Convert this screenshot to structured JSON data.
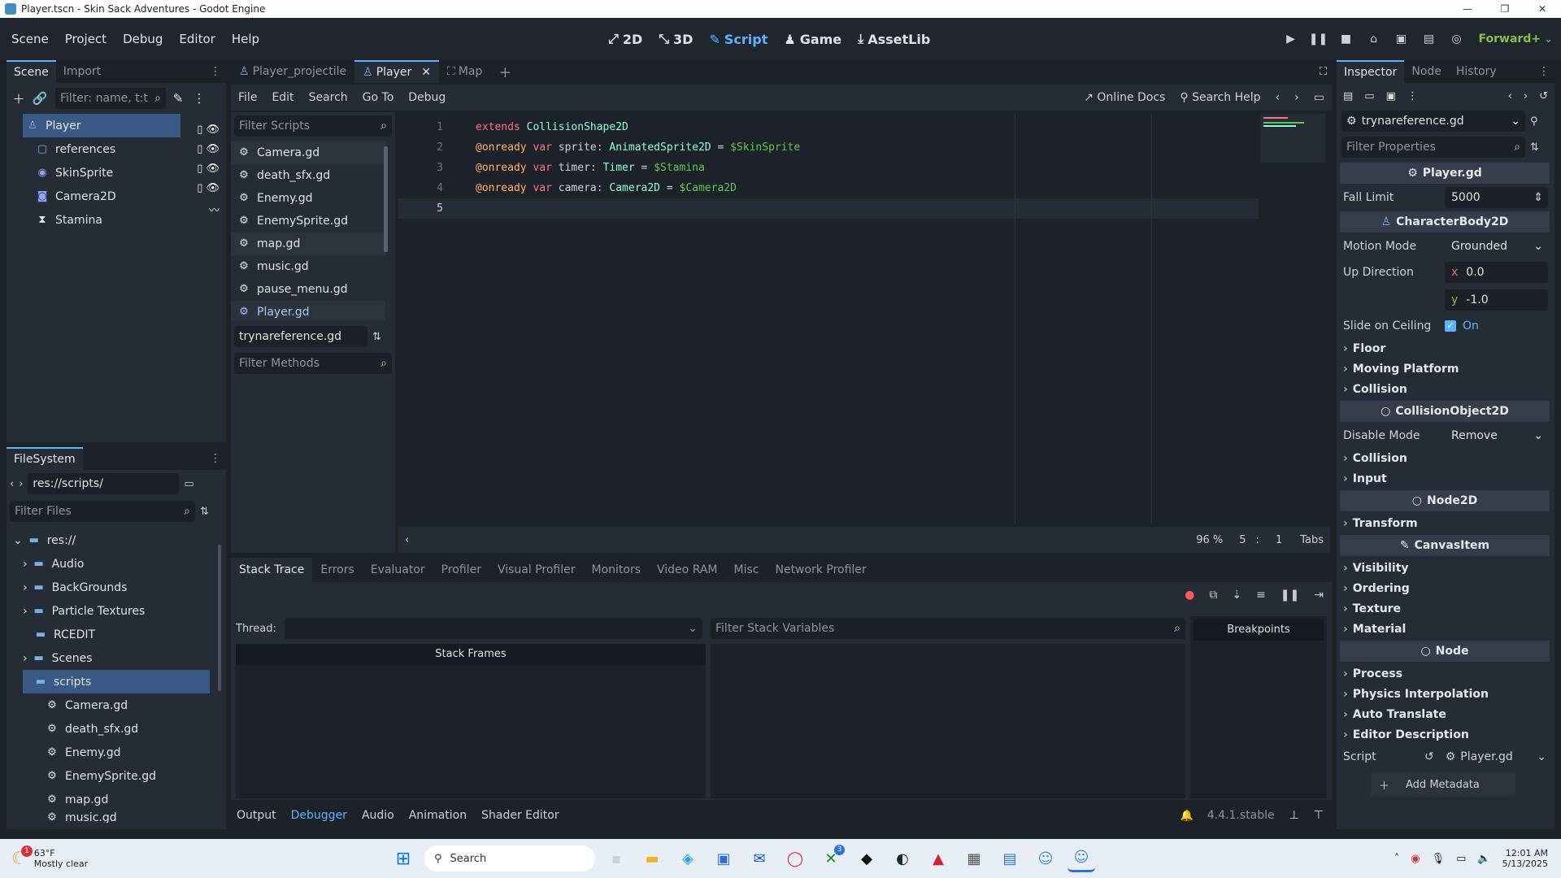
{
  "window": {
    "title": "Player.tscn - Skin Sack Adventures - Godot Engine"
  },
  "menu": {
    "items": [
      "Scene",
      "Project",
      "Debug",
      "Editor",
      "Help"
    ]
  },
  "workspaces": [
    "2D",
    "3D",
    "Script",
    "Game",
    "AssetLib"
  ],
  "renderer": "Forward+",
  "scene_dock": {
    "tabs": [
      "Scene",
      "Import"
    ],
    "filter_placeholder": "Filter: name, t:t",
    "nodes": [
      "Player",
      "references",
      "SkinSprite",
      "Camera2D",
      "Stamina"
    ]
  },
  "filesystem": {
    "tab": "FileSystem",
    "path": "res://scripts/",
    "filter_placeholder": "Filter Files",
    "items": [
      "res://",
      "Audio",
      "BackGrounds",
      "Particle Textures",
      "RCEDIT",
      "Scenes",
      "scripts",
      "Camera.gd",
      "death_sfx.gd",
      "Enemy.gd",
      "EnemySprite.gd",
      "map.gd",
      "music.gd"
    ]
  },
  "scene_tabs": [
    "Player_projectile",
    "Player",
    "Map"
  ],
  "script_menu": [
    "File",
    "Edit",
    "Search",
    "Go To",
    "Debug"
  ],
  "script_toolbar": {
    "online_docs": "Online Docs",
    "search_help": "Search Help"
  },
  "script_list": {
    "filter_placeholder": "Filter Scripts",
    "items": [
      "Camera.gd",
      "death_sfx.gd",
      "Enemy.gd",
      "EnemySprite.gd",
      "map.gd",
      "music.gd",
      "pause_menu.gd",
      "Player.gd"
    ],
    "current": "trynareference.gd",
    "methods_placeholder": "Filter Methods"
  },
  "code": {
    "line_numbers": [
      "1",
      "2",
      "3",
      "4",
      "5"
    ],
    "lines": [
      {
        "kw": "extends",
        "rest": " ",
        "ty": "CollisionShape2D",
        "rest2": "",
        "nm": ""
      },
      {
        "an": "@onready",
        "kw": " var",
        "rest": " sprite: ",
        "ty": "AnimatedSprite2D",
        "rest2": " = ",
        "nm": "$SkinSprite"
      },
      {
        "an": "@onready",
        "kw": " var",
        "rest": " timer: ",
        "ty": "Timer",
        "rest2": " = ",
        "nm": "$Stamina"
      },
      {
        "an": "@onready",
        "kw": " var",
        "rest": " camera: ",
        "ty": "Camera2D",
        "rest2": " = ",
        "nm": "$Camera2D"
      }
    ],
    "zoom": "96 %",
    "line": "5",
    "col": "1",
    "indent": "Tabs"
  },
  "debugger": {
    "tabs": [
      "Stack Trace",
      "Errors",
      "Evaluator",
      "Profiler",
      "Visual Profiler",
      "Monitors",
      "Video RAM",
      "Misc",
      "Network Profiler"
    ],
    "thread_label": "Thread:",
    "stack_vars_placeholder": "Filter Stack Variables",
    "stack_frames": "Stack Frames",
    "breakpoints": "Breakpoints"
  },
  "bottom_panel": {
    "tabs": [
      "Output",
      "Debugger",
      "Audio",
      "Animation",
      "Shader Editor"
    ],
    "version": "4.4.1.stable"
  },
  "inspector": {
    "tabs": [
      "Inspector",
      "Node",
      "History"
    ],
    "resource": "trynareference.gd",
    "filter_placeholder": "Filter Properties",
    "script_section": "Player.gd",
    "fall_limit_label": "Fall Limit",
    "fall_limit": "5000",
    "class1": "CharacterBody2D",
    "motion_mode_label": "Motion Mode",
    "motion_mode": "Grounded",
    "up_direction_label": "Up Direction",
    "up_x_label": "x",
    "up_x": "0.0",
    "up_y_label": "y",
    "up_y": "-1.0",
    "slide_label": "Slide on Ceiling",
    "slide": "On",
    "groups1": [
      "Floor",
      "Moving Platform",
      "Collision"
    ],
    "class2": "CollisionObject2D",
    "disable_mode_label": "Disable Mode",
    "disable_mode": "Remove",
    "groups2": [
      "Collision",
      "Input"
    ],
    "class3": "Node2D",
    "groups3": [
      "Transform"
    ],
    "class4": "CanvasItem",
    "groups4": [
      "Visibility",
      "Ordering",
      "Texture",
      "Material"
    ],
    "class5": "Node",
    "groups5": [
      "Process",
      "Physics Interpolation",
      "Auto Translate",
      "Editor Description"
    ],
    "script_label": "Script",
    "script_value": "Player.gd",
    "add_metadata": "Add Metadata"
  },
  "taskbar": {
    "temp": "63°F",
    "weather": "Mostly clear",
    "search": "Search",
    "time": "12:01 AM",
    "date": "5/13/2025",
    "badge": "1",
    "xbox_badge": "3"
  }
}
